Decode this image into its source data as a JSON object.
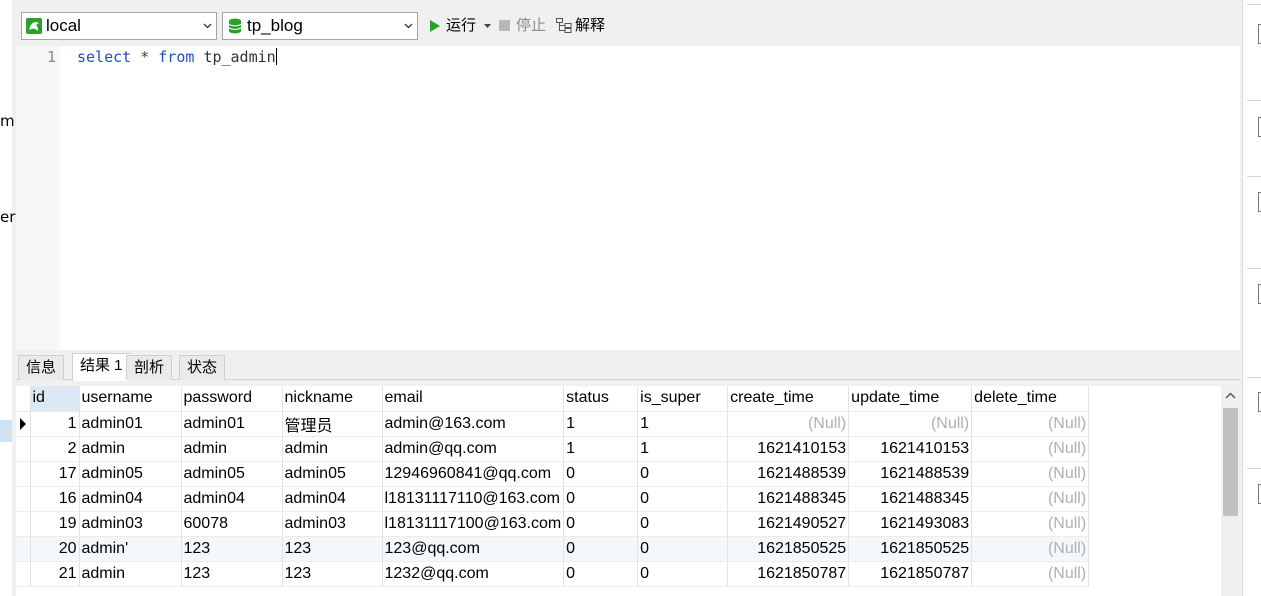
{
  "left_fragments": [
    "m",
    "er"
  ],
  "toolbar": {
    "connection": "local",
    "database": "tp_blog",
    "run_label": "运行",
    "stop_label": "停止",
    "explain_label": "解释"
  },
  "editor": {
    "line_number": "1",
    "keyword_select": "select",
    "star": "*",
    "keyword_from": "from",
    "table_name": "tp_admin"
  },
  "tabs": [
    "信息",
    "结果 1",
    "剖析",
    "状态"
  ],
  "active_tab": "结果 1",
  "columns": [
    "id",
    "username",
    "password",
    "nickname",
    "email",
    "status",
    "is_super",
    "create_time",
    "update_time",
    "delete_time"
  ],
  "rows": [
    [
      "1",
      "admin01",
      "admin01",
      "管理员",
      "admin@163.com",
      "1",
      "1",
      "(Null)",
      "(Null)",
      "(Null)"
    ],
    [
      "2",
      "admin",
      "admin",
      "admin",
      "admin@qq.com",
      "1",
      "1",
      "1621410153",
      "1621410153",
      "(Null)"
    ],
    [
      "17",
      "admin05",
      "admin05",
      "admin05",
      "12946960841@qq.com",
      "0",
      "0",
      "1621488539",
      "1621488539",
      "(Null)"
    ],
    [
      "16",
      "admin04",
      "admin04",
      "admin04",
      "l18131117110@163.com",
      "0",
      "0",
      "1621488345",
      "1621488345",
      "(Null)"
    ],
    [
      "19",
      "admin03",
      "60078",
      "admin03",
      "l18131117100@163.com",
      "0",
      "0",
      "1621490527",
      "1621493083",
      "(Null)"
    ],
    [
      "20",
      "admin'",
      "123",
      "123",
      "123@qq.com",
      "0",
      "0",
      "1621850525",
      "1621850525",
      "(Null)"
    ],
    [
      "21",
      "admin",
      "123",
      "123",
      "1232@qq.com",
      "0",
      "0",
      "1621850787",
      "1621850787",
      "(Null)"
    ]
  ],
  "colors": {
    "keyword": "#1f4dc7",
    "run_icon": "#2aa12a",
    "db_icon": "#2aa12a",
    "null_text": "#b0b0b0",
    "header_highlight": "#dce9f5"
  },
  "icons": {
    "connection": "mysql-connection-icon",
    "database": "database-icon",
    "run": "play-icon",
    "stop": "stop-icon",
    "explain": "explain-icon"
  }
}
